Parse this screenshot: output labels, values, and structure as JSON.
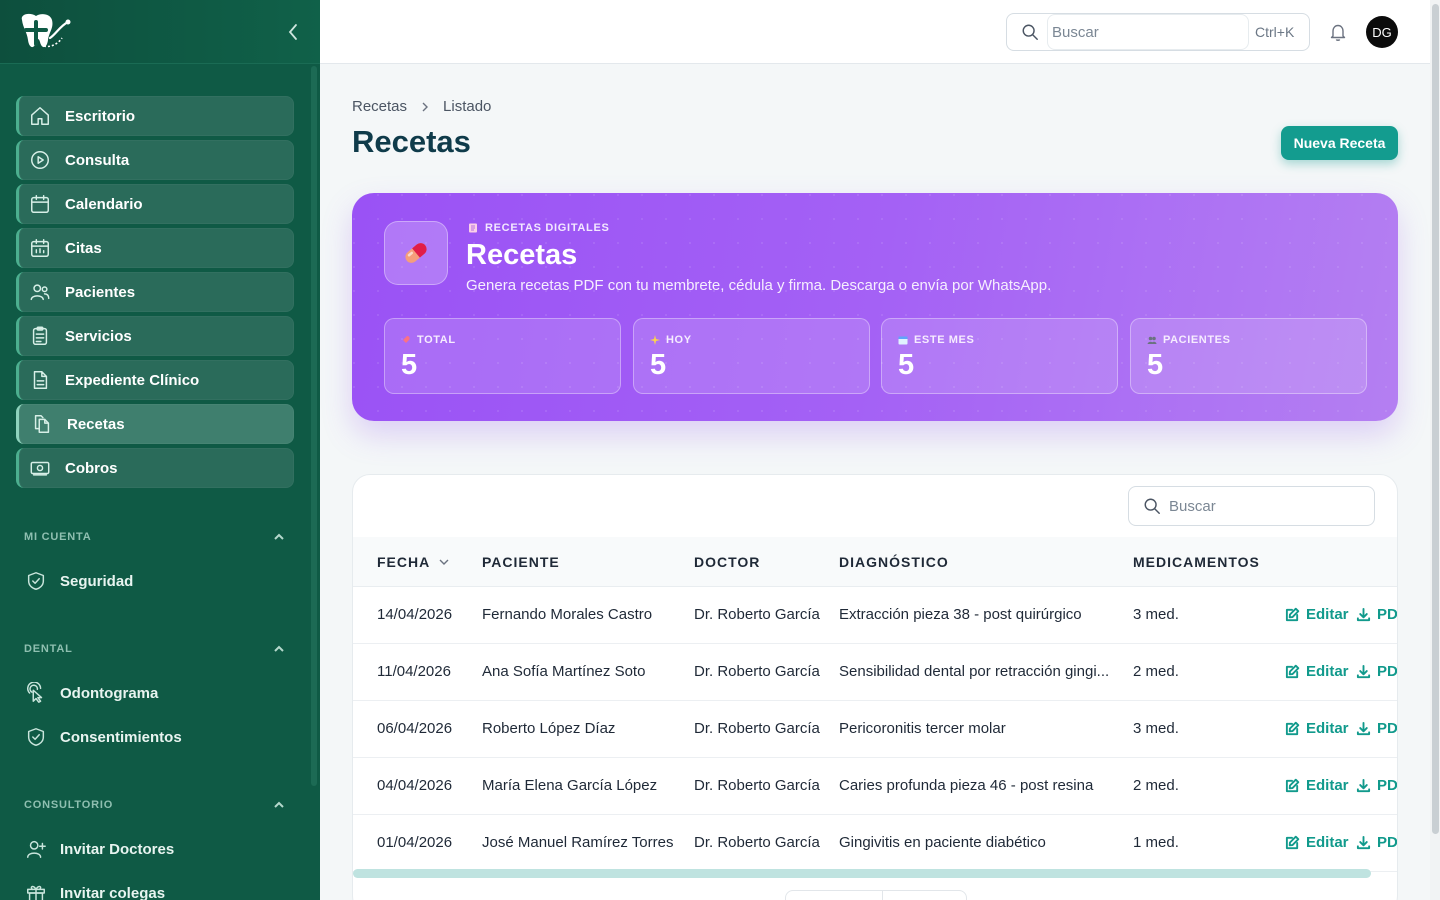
{
  "sidebar": {
    "nav": [
      {
        "label": "Escritorio",
        "icon": "home-icon"
      },
      {
        "label": "Consulta",
        "icon": "play-circle-icon"
      },
      {
        "label": "Calendario",
        "icon": "calendar-icon"
      },
      {
        "label": "Citas",
        "icon": "calendar-grid-icon"
      },
      {
        "label": "Pacientes",
        "icon": "users-icon"
      },
      {
        "label": "Servicios",
        "icon": "clipboard-list-icon"
      },
      {
        "label": "Expediente Clínico",
        "icon": "document-icon"
      },
      {
        "label": "Recetas",
        "icon": "copy-document-icon",
        "active": true
      },
      {
        "label": "Cobros",
        "icon": "cash-icon"
      }
    ],
    "sections": [
      {
        "title": "MI CUENTA",
        "items": [
          {
            "label": "Seguridad",
            "icon": "shield-check-icon"
          }
        ]
      },
      {
        "title": "DENTAL",
        "items": [
          {
            "label": "Odontograma",
            "icon": "pointer-click-icon"
          },
          {
            "label": "Consentimientos",
            "icon": "shield-check-icon"
          }
        ]
      },
      {
        "title": "CONSULTORIO",
        "items": [
          {
            "label": "Invitar Doctores",
            "icon": "user-plus-icon"
          },
          {
            "label": "Invitar colegas",
            "icon": "gift-icon"
          }
        ]
      }
    ]
  },
  "topbar": {
    "search_placeholder": "Buscar",
    "shortcut": "Ctrl+K",
    "avatar_initials": "DG"
  },
  "breadcrumb": {
    "root": "Recetas",
    "current": "Listado"
  },
  "page": {
    "title": "Recetas",
    "new_button": "Nueva Receta"
  },
  "hero": {
    "kicker": "RECETAS DIGITALES",
    "title": "Recetas",
    "description": "Genera recetas PDF con tu membrete, cédula y firma. Descarga o envía por WhatsApp.",
    "stats": [
      {
        "label": "TOTAL",
        "value": "5",
        "icon": "rocket-icon"
      },
      {
        "label": "HOY",
        "value": "5",
        "icon": "sparkle-icon"
      },
      {
        "label": "ESTE MES",
        "value": "5",
        "icon": "calendar-icon"
      },
      {
        "label": "PACIENTES",
        "value": "5",
        "icon": "users-icon"
      }
    ],
    "colors": {
      "from": "#9a52f5",
      "to": "#b47ff2"
    }
  },
  "table": {
    "search_placeholder": "Buscar",
    "columns": [
      "FECHA",
      "PACIENTE",
      "DOCTOR",
      "DIAGNÓSTICO",
      "MEDICAMENTOS"
    ],
    "actions": {
      "edit": "Editar",
      "pdf": "PDF"
    },
    "rows": [
      {
        "fecha": "14/04/2026",
        "paciente": "Fernando Morales Castro",
        "doctor": "Dr. Roberto García",
        "diagnostico": "Extracción pieza 38 - post quirúrgico",
        "medicamentos": "3 med."
      },
      {
        "fecha": "11/04/2026",
        "paciente": "Ana Sofía Martínez Soto",
        "doctor": "Dr. Roberto García",
        "diagnostico": "Sensibilidad dental por retracción gingi...",
        "medicamentos": "2 med."
      },
      {
        "fecha": "06/04/2026",
        "paciente": "Roberto López Díaz",
        "doctor": "Dr. Roberto García",
        "diagnostico": "Pericoronitis tercer molar",
        "medicamentos": "3 med."
      },
      {
        "fecha": "04/04/2026",
        "paciente": "María Elena García López",
        "doctor": "Dr. Roberto García",
        "diagnostico": "Caries profunda pieza 46 - post resina",
        "medicamentos": "2 med."
      },
      {
        "fecha": "01/04/2026",
        "paciente": "José Manuel Ramírez Torres",
        "doctor": "Dr. Roberto García",
        "diagnostico": "Gingivitis en paciente diabético",
        "medicamentos": "1 med."
      }
    ]
  },
  "colors": {
    "sidebar": "#0f5a45",
    "accent": "#139c8f",
    "title": "#0f3b4a"
  }
}
